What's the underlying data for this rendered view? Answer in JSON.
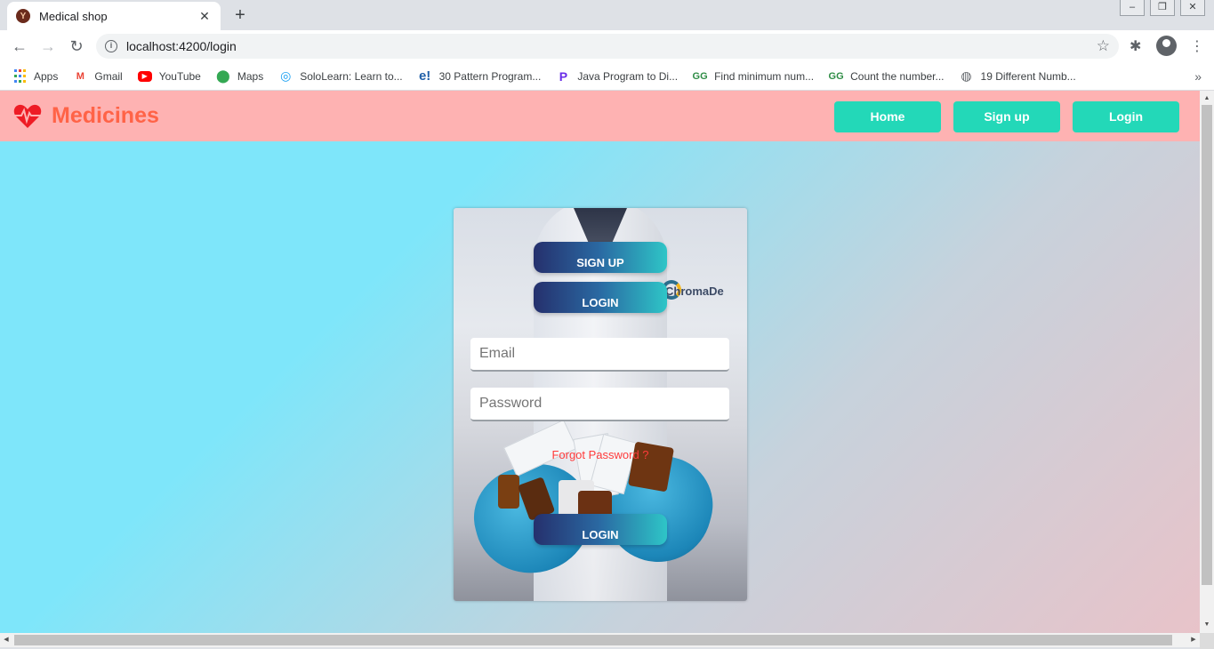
{
  "browser": {
    "tab_title": "Medical shop",
    "url": "localhost:4200/login",
    "bookmarks": [
      {
        "label": "Apps",
        "icon": "apps-grid-icon"
      },
      {
        "label": "Gmail",
        "icon": "gmail-icon"
      },
      {
        "label": "YouTube",
        "icon": "youtube-icon"
      },
      {
        "label": "Maps",
        "icon": "maps-icon"
      },
      {
        "label": "SoloLearn: Learn to...",
        "icon": "sololearn-icon"
      },
      {
        "label": "30 Pattern Program...",
        "icon": "edureka-icon"
      },
      {
        "label": "Java Program to Di...",
        "icon": "programiz-icon"
      },
      {
        "label": "Find minimum num...",
        "icon": "geeksforgeeks-icon"
      },
      {
        "label": "Count the number...",
        "icon": "geeksforgeeks-icon"
      },
      {
        "label": "19 Different Numb...",
        "icon": "globe-icon"
      }
    ]
  },
  "navbar": {
    "brand": "Medicines",
    "brand_color": "#ff6347",
    "background": "#feb2b2",
    "buttons": {
      "home": "Home",
      "signup": "Sign up",
      "login": "Login"
    },
    "button_color": "#23d8b8"
  },
  "card": {
    "signup_label": "SIGN UP",
    "login_label": "LOGIN",
    "email_placeholder": "Email",
    "password_placeholder": "Password",
    "forgot_label": "Forgot Password ?",
    "submit_label": "LOGIN",
    "background_brand_text": "ChromaDe"
  }
}
